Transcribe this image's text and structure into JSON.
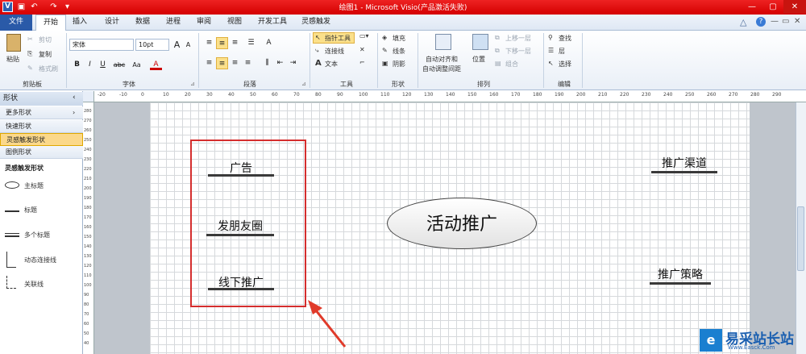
{
  "titlebar": {
    "title": "绘图1 - Microsoft Visio(产品激活失败)"
  },
  "tabs": [
    "文件",
    "开始",
    "插入",
    "设计",
    "数据",
    "进程",
    "审阅",
    "视图",
    "开发工具",
    "灵感触发"
  ],
  "ribbon": {
    "clipboard": {
      "paste": "粘贴",
      "cut": "剪切",
      "copy": "复制",
      "format_painter": "格式刷",
      "label": "剪贴板"
    },
    "font": {
      "family": "宋体",
      "size": "10pt",
      "label": "字体",
      "bold": "B",
      "italic": "I",
      "underline": "U",
      "strike": "abc",
      "size_up": "A",
      "size_down": "A",
      "color": "A"
    },
    "paragraph": {
      "label": "段落"
    },
    "tools": {
      "pointer": "指针工具",
      "connector": "连接线",
      "text": "文本",
      "label": "工具"
    },
    "shape": {
      "fill": "填充",
      "line": "线条",
      "shadow": "阴影",
      "label": "形状"
    },
    "arrange": {
      "auto_align": "自动对齐和",
      "auto_space": "自动调整间距",
      "position": "位置",
      "bring_forward": "上移一层",
      "send_backward": "下移一层",
      "group": "组合",
      "label": "排列"
    },
    "editing": {
      "find": "查找",
      "layers": "层",
      "select": "选择",
      "label": "编辑"
    }
  },
  "sidebar": {
    "header": "形状",
    "rows": [
      "更多形状",
      "快速形状",
      "灵感触发形状",
      "图例形状"
    ],
    "stencil_title": "灵感触发形状",
    "stencil_items": [
      "主标题",
      "标题",
      "多个标题",
      "动态连接线",
      "关联线"
    ]
  },
  "ruler_top": [
    "-20",
    "-10",
    "0",
    "10",
    "20",
    "30",
    "40",
    "50",
    "60",
    "70",
    "80",
    "90",
    "100",
    "110",
    "120",
    "130",
    "140",
    "150",
    "160",
    "170",
    "180",
    "190",
    "200",
    "210",
    "220",
    "230",
    "240",
    "250",
    "260",
    "270",
    "280",
    "290"
  ],
  "ruler_left": [
    "280",
    "270",
    "260",
    "250",
    "240",
    "230",
    "220",
    "210",
    "200",
    "190",
    "180",
    "170",
    "160",
    "150",
    "140",
    "130",
    "120",
    "110",
    "100",
    "90",
    "80",
    "70",
    "60",
    "50",
    "40"
  ],
  "diagram": {
    "left_items": [
      "广告",
      "发朋友圈",
      "线下推广"
    ],
    "center": "活动推广",
    "right_items": [
      "推广渠道",
      "推广策略"
    ]
  },
  "watermark": {
    "text": "易采站长站",
    "sub": "Www.Easck.Com"
  },
  "colors": {
    "title_bar": "#d40000",
    "highlight_box": "#d42e2e",
    "selected_row": "#fbd88a"
  }
}
